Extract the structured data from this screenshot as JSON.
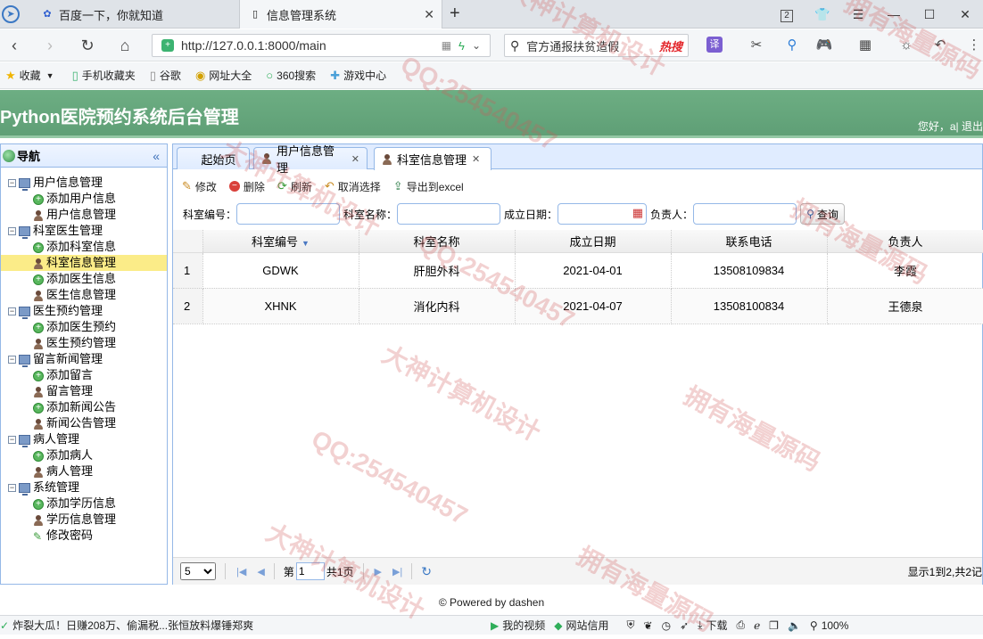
{
  "browser": {
    "tabs": [
      {
        "title": "百度一下，你就知道",
        "icon": "paw-icon"
      },
      {
        "title": "信息管理系统",
        "icon": "page-icon"
      }
    ],
    "tab_counter": "2",
    "url": "http://127.0.0.1:8000/main",
    "search_placeholder": "官方通报扶贫造假",
    "search_hot": "热搜",
    "bookmarks": [
      {
        "label": "收藏",
        "icon": "star-icon"
      },
      {
        "label": "手机收藏夹",
        "icon": "phone-icon"
      },
      {
        "label": "谷歌",
        "icon": "page-icon"
      },
      {
        "label": "网址大全",
        "icon": "globe-icon"
      },
      {
        "label": "360搜索",
        "icon": "search-icon"
      },
      {
        "label": "游戏中心",
        "icon": "game-icon"
      }
    ]
  },
  "app": {
    "title": "Python医院预约系统后台管理",
    "user": "您好，a| 退出"
  },
  "sidebar": {
    "title": "导航",
    "groups": [
      {
        "label": "用户信息管理",
        "items": [
          {
            "label": "添加用户信息",
            "icon": "add"
          },
          {
            "label": "用户信息管理",
            "icon": "user"
          }
        ]
      },
      {
        "label": "科室医生管理",
        "items": [
          {
            "label": "添加科室信息",
            "icon": "add"
          },
          {
            "label": "科室信息管理",
            "icon": "user",
            "selected": true
          },
          {
            "label": "添加医生信息",
            "icon": "add"
          },
          {
            "label": "医生信息管理",
            "icon": "user"
          }
        ]
      },
      {
        "label": "医生预约管理",
        "items": [
          {
            "label": "添加医生预约",
            "icon": "add"
          },
          {
            "label": "医生预约管理",
            "icon": "user"
          }
        ]
      },
      {
        "label": "留言新闻管理",
        "items": [
          {
            "label": "添加留言",
            "icon": "add"
          },
          {
            "label": "留言管理",
            "icon": "user"
          },
          {
            "label": "添加新闻公告",
            "icon": "add"
          },
          {
            "label": "新闻公告管理",
            "icon": "user"
          }
        ]
      },
      {
        "label": "病人管理",
        "items": [
          {
            "label": "添加病人",
            "icon": "add"
          },
          {
            "label": "病人管理",
            "icon": "user"
          }
        ]
      },
      {
        "label": "系统管理",
        "items": [
          {
            "label": "添加学历信息",
            "icon": "add"
          },
          {
            "label": "学历信息管理",
            "icon": "user"
          },
          {
            "label": "修改密码",
            "icon": "pen"
          }
        ]
      }
    ]
  },
  "main": {
    "tabs": [
      {
        "label": "起始页",
        "closable": false
      },
      {
        "label": "用户信息管理",
        "closable": true
      },
      {
        "label": "科室信息管理",
        "closable": true,
        "active": true
      }
    ],
    "toolbar": {
      "edit": "修改",
      "delete": "删除",
      "refresh": "刷新",
      "cancel_select": "取消选择",
      "export": "导出到excel"
    },
    "filters": {
      "code_label": "科室编号：",
      "name_label": "科室名称：",
      "date_label": "成立日期：",
      "head_label": "负责人：",
      "query_button": "查询"
    },
    "table": {
      "columns": [
        "科室编号",
        "科室名称",
        "成立日期",
        "联系电话",
        "负责人"
      ],
      "rows": [
        {
          "n": "1",
          "cells": [
            "GDWK",
            "肝胆外科",
            "2021-04-01",
            "13508109834",
            "李霞"
          ]
        },
        {
          "n": "2",
          "cells": [
            "XHNK",
            "消化内科",
            "2021-04-07",
            "13508100834",
            "王德泉"
          ]
        }
      ]
    },
    "pager": {
      "page_size": "5",
      "page_prefix": "第",
      "page_value": "1",
      "page_total": "共1页",
      "info": "显示1到2,共2记"
    }
  },
  "footer": {
    "text": "© Powered by dashen"
  },
  "statusbar": {
    "news": "炸裂大瓜！日赚208万、偷漏税...张恒放料爆锤郑爽",
    "video": "我的视频",
    "credit": "网站信用",
    "download": "下载",
    "zoom": "100%"
  },
  "watermarks": [
    "大神计算机设计",
    "拥有海量源码",
    "QQ:254540457"
  ]
}
